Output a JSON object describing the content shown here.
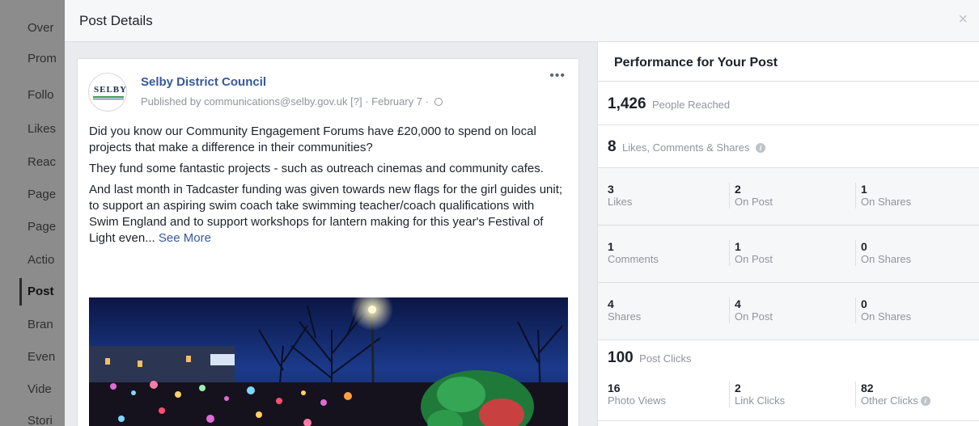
{
  "background_nav": {
    "items": [
      "Over",
      "Prom",
      "Follo",
      "Likes",
      "Reac",
      "Page",
      "Page",
      "Actio",
      "Post",
      "Bran",
      "Even",
      "Vide",
      "Stori"
    ],
    "active_index": 8
  },
  "modal": {
    "title": "Post Details",
    "close_label": "×"
  },
  "post": {
    "page_name": "Selby District Council",
    "avatar_text": "SELBY",
    "published_prefix": "Published by",
    "publisher_email": "communications@selby.gov.uk",
    "published_suffix": "[?] · February 7 ·",
    "more_label": "•••",
    "paragraphs": [
      "Did you know our Community Engagement Forums have £20,000 to spend on local projects that make a difference in their communities?",
      "They fund some fantastic projects - such as outreach cinemas and community cafes.",
      "And last month in Tadcaster funding was given towards new flags for the girl guides unit; to support an aspiring swim coach take swimming teacher/coach qualifications with Swim England and to support workshops for lantern making for this year's Festival of Light even..."
    ],
    "see_more": "See More"
  },
  "performance": {
    "title": "Performance for Your Post",
    "people_reached": {
      "value": "1,426",
      "label": "People Reached"
    },
    "engagement": {
      "value": "8",
      "label": "Likes, Comments & Shares"
    },
    "likes_row": [
      {
        "value": "3",
        "label": "Likes"
      },
      {
        "value": "2",
        "label": "On Post"
      },
      {
        "value": "1",
        "label": "On Shares"
      }
    ],
    "comments_row": [
      {
        "value": "1",
        "label": "Comments"
      },
      {
        "value": "1",
        "label": "On Post"
      },
      {
        "value": "0",
        "label": "On Shares"
      }
    ],
    "shares_row": [
      {
        "value": "4",
        "label": "Shares"
      },
      {
        "value": "4",
        "label": "On Post"
      },
      {
        "value": "0",
        "label": "On Shares"
      }
    ],
    "post_clicks": {
      "value": "100",
      "label": "Post Clicks"
    },
    "clicks_row": [
      {
        "value": "16",
        "label": "Photo Views"
      },
      {
        "value": "2",
        "label": "Link Clicks"
      },
      {
        "value": "82",
        "label": "Other Clicks"
      }
    ]
  },
  "colors": {
    "link": "#365899",
    "muted": "#90949c",
    "panel_bg": "#f6f7f9"
  }
}
